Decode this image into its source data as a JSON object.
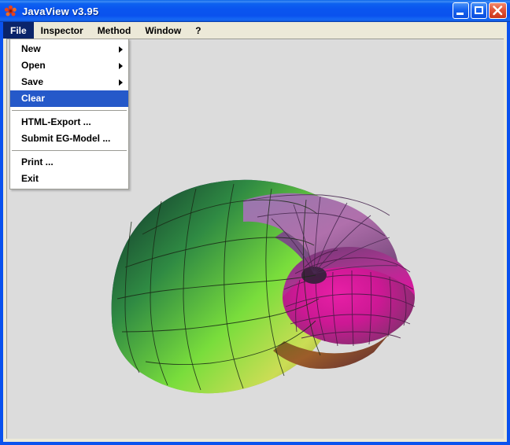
{
  "window": {
    "title": "JavaView v3.95",
    "icon": "javaview-flower-icon",
    "buttons": {
      "minimize": "minimize-button",
      "maximize": "maximize-button",
      "close": "close-button"
    },
    "accent_color": "#0a52ee",
    "titlebar_text_color": "#ffffff"
  },
  "menubar": {
    "items": [
      {
        "label": "File",
        "active": true
      },
      {
        "label": "Inspector",
        "active": false
      },
      {
        "label": "Method",
        "active": false
      },
      {
        "label": "Window",
        "active": false
      },
      {
        "label": "?",
        "active": false
      }
    ]
  },
  "file_menu": {
    "open": true,
    "highlight_color": "#2559c9",
    "items": [
      {
        "label": "New",
        "submenu": true,
        "selected": false,
        "separator_after": false
      },
      {
        "label": "Open",
        "submenu": true,
        "selected": false,
        "separator_after": false
      },
      {
        "label": "Save",
        "submenu": true,
        "selected": false,
        "separator_after": false
      },
      {
        "label": "Clear",
        "submenu": false,
        "selected": true,
        "separator_after": true
      },
      {
        "label": "HTML-Export ...",
        "submenu": false,
        "selected": false,
        "separator_after": false
      },
      {
        "label": "Submit EG-Model ...",
        "submenu": false,
        "selected": false,
        "separator_after": true
      },
      {
        "label": "Print ...",
        "submenu": false,
        "selected": false,
        "separator_after": false
      },
      {
        "label": "Exit",
        "submenu": false,
        "selected": false,
        "separator_after": false
      }
    ]
  },
  "canvas": {
    "background_color": "#dcdcdc",
    "model_name": "spiral-shell-surface",
    "description": "3D faceted nautilus shell surface with rainbow color gradient",
    "colors": {
      "rim_blue": "#3b3f8c",
      "dark_green": "#143c2e",
      "mid_green": "#3aa24a",
      "bright_green": "#7ee03c",
      "yellow_green": "#cfe05a",
      "olive": "#8f8a2a",
      "orange": "#b5682a",
      "magenta": "#d9189b",
      "purple": "#8e4a8e",
      "violet": "#5a3f8f"
    }
  }
}
